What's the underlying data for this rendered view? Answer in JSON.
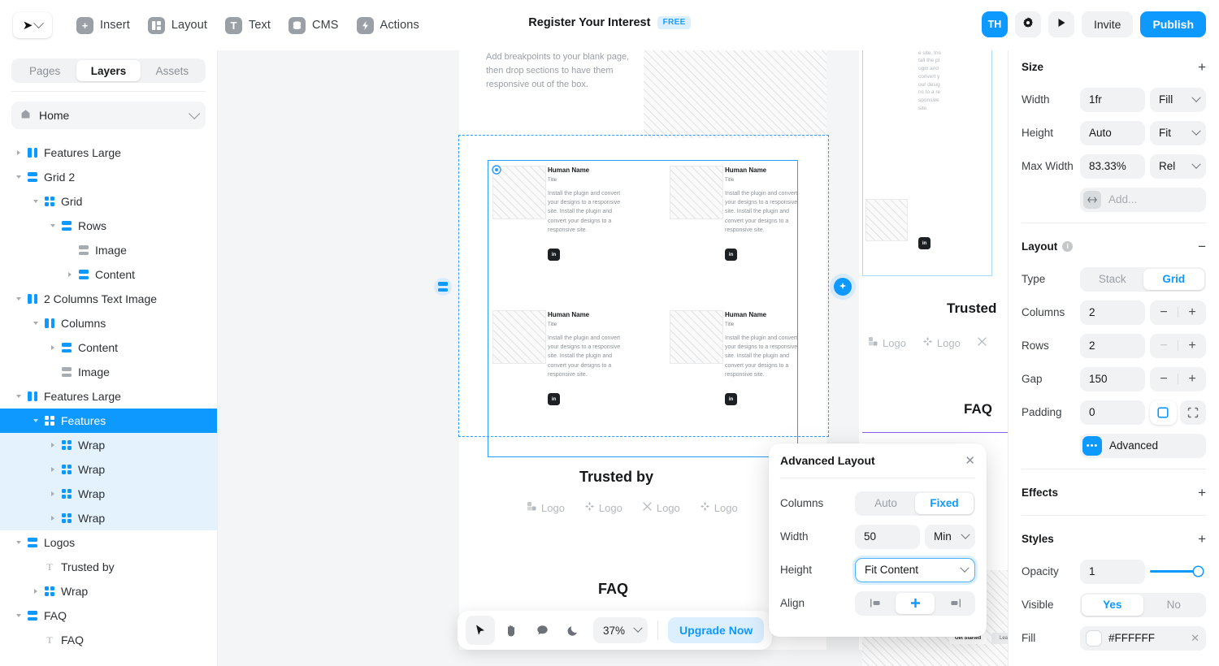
{
  "topbar": {
    "logo_icon": "framer-logo-icon",
    "logo_chevron": "chevron-down-icon",
    "menu": [
      {
        "label": "Insert",
        "icon": "plus-icon",
        "glyph": "+"
      },
      {
        "label": "Layout",
        "icon": "layout-icon",
        "glyph": "▥"
      },
      {
        "label": "Text",
        "icon": "text-icon",
        "glyph": "T"
      },
      {
        "label": "CMS",
        "icon": "database-icon",
        "glyph": "≡"
      },
      {
        "label": "Actions",
        "icon": "lightning-icon",
        "glyph": "⚡"
      }
    ],
    "doc_title": "Register Your Interest",
    "plan_badge": "FREE",
    "avatar_initials": "TH",
    "settings_icon": "gear-icon",
    "preview_icon": "play-icon",
    "invite_label": "Invite",
    "publish_label": "Publish",
    "accent": "#0d99ff"
  },
  "left_panel": {
    "tabs": [
      {
        "label": "Pages",
        "active": false
      },
      {
        "label": "Layers",
        "active": true
      },
      {
        "label": "Assets",
        "active": false
      }
    ],
    "page": {
      "label": "Home",
      "icon": "home-icon",
      "chevron": "chevron-down-icon"
    },
    "layers": [
      {
        "label": "Features Large",
        "icon": "columns-icon",
        "depth": 1,
        "twisty": "collapsed",
        "state": "normal"
      },
      {
        "label": "Grid 2",
        "icon": "rows-icon",
        "depth": 1,
        "twisty": "expanded",
        "state": "normal"
      },
      {
        "label": "Grid",
        "icon": "grid-icon",
        "depth": 2,
        "twisty": "expanded",
        "state": "normal"
      },
      {
        "label": "Rows",
        "icon": "rows-icon",
        "depth": 3,
        "twisty": "expanded",
        "state": "normal"
      },
      {
        "label": "Image",
        "icon": "image-icon",
        "depth": 4,
        "twisty": "none",
        "state": "normal"
      },
      {
        "label": "Content",
        "icon": "rows-icon",
        "depth": 4,
        "twisty": "collapsed",
        "state": "normal"
      },
      {
        "label": "2 Columns Text Image",
        "icon": "columns-icon",
        "depth": 1,
        "twisty": "expanded",
        "state": "normal"
      },
      {
        "label": "Columns",
        "icon": "columns-icon",
        "depth": 2,
        "twisty": "expanded",
        "state": "normal"
      },
      {
        "label": "Content",
        "icon": "rows-icon",
        "depth": 3,
        "twisty": "collapsed",
        "state": "normal"
      },
      {
        "label": "Image",
        "icon": "image-icon",
        "depth": 3,
        "twisty": "none",
        "state": "normal"
      },
      {
        "label": "Features Large",
        "icon": "columns-icon",
        "depth": 1,
        "twisty": "expanded",
        "state": "normal"
      },
      {
        "label": "Features",
        "icon": "grid-icon",
        "depth": 2,
        "twisty": "expanded",
        "state": "selected"
      },
      {
        "label": "Wrap",
        "icon": "grid-icon",
        "depth": 3,
        "twisty": "collapsed",
        "state": "highlighted"
      },
      {
        "label": "Wrap",
        "icon": "grid-icon",
        "depth": 3,
        "twisty": "collapsed",
        "state": "highlighted"
      },
      {
        "label": "Wrap",
        "icon": "grid-icon",
        "depth": 3,
        "twisty": "collapsed",
        "state": "highlighted"
      },
      {
        "label": "Wrap",
        "icon": "grid-icon",
        "depth": 3,
        "twisty": "collapsed",
        "state": "highlighted"
      },
      {
        "label": "Logos",
        "icon": "rows-icon",
        "depth": 1,
        "twisty": "expanded",
        "state": "normal"
      },
      {
        "label": "Trusted by",
        "icon": "text-layer-icon",
        "depth": 2,
        "twisty": "none",
        "state": "normal"
      },
      {
        "label": "Wrap",
        "icon": "grid-icon",
        "depth": 2,
        "twisty": "collapsed",
        "state": "normal"
      },
      {
        "label": "FAQ",
        "icon": "rows-icon",
        "depth": 1,
        "twisty": "expanded",
        "state": "normal"
      },
      {
        "label": "FAQ",
        "icon": "text-layer-icon",
        "depth": 2,
        "twisty": "none",
        "state": "normal"
      }
    ]
  },
  "canvas": {
    "breakpoint_note": "Add breakpoints to your blank page, then drop sections to have them responsive out of the box.",
    "cards": [
      {
        "name": "Human Name",
        "title": "Title",
        "body": "Install the plugin and convert your designs to a responsive site. Install the plugin and convert your designs to a responsive site.",
        "social_icon": "linkedin-icon",
        "social_glyph": "in"
      },
      {
        "name": "Human Name",
        "title": "Title",
        "body": "Install the plugin and convert your designs to a responsive site. Install the plugin and convert your designs to a responsive site.",
        "social_icon": "linkedin-icon",
        "social_glyph": "in"
      },
      {
        "name": "Human Name",
        "title": "Title",
        "body": "Install the plugin and convert your designs to a responsive site. Install the plugin and convert your designs to a responsive site.",
        "social_icon": "linkedin-icon",
        "social_glyph": "in"
      },
      {
        "name": "Human Name",
        "title": "Title",
        "body": "Install the plugin and convert your designs to a responsive site. Install the plugin and convert your designs to a responsive site.",
        "social_icon": "linkedin-icon",
        "social_glyph": "in"
      }
    ],
    "trusted_by": "Trusted by",
    "logos": [
      {
        "label": "Logo",
        "icon": "blocks-logo-icon"
      },
      {
        "label": "Logo",
        "icon": "clover-logo-icon"
      },
      {
        "label": "Logo",
        "icon": "cross-logo-icon"
      },
      {
        "label": "Logo",
        "icon": "diamond-logo-icon"
      }
    ],
    "faq": "FAQ",
    "mobile_trusted_by": "Trusted",
    "mobile_faq": "FAQ",
    "get_started": "Get Started",
    "learn_more": "Lea",
    "add_badge_icon": "add-section-icon",
    "rows-badge_icon": "rows-handle-icon"
  },
  "canvas_toolbar": {
    "tools": [
      {
        "icon": "cursor-icon",
        "glyph": "➤",
        "active": true
      },
      {
        "icon": "hand-icon",
        "glyph": "✋",
        "active": false
      },
      {
        "icon": "comment-icon",
        "glyph": "💬",
        "active": false
      },
      {
        "icon": "moon-icon",
        "glyph": "🌙",
        "active": false
      }
    ],
    "zoom_value": "37%",
    "zoom_chevron": "chevron-down-icon",
    "upgrade_label": "Upgrade Now"
  },
  "popover": {
    "title": "Advanced Layout",
    "close_icon": "close-icon",
    "rows": {
      "columns": {
        "label": "Columns",
        "options": [
          "Auto",
          "Fixed"
        ],
        "selected": "Fixed"
      },
      "width": {
        "label": "Width",
        "value": "50",
        "unit": "Min",
        "unit_chevron": "chevron-down-icon"
      },
      "height": {
        "label": "Height",
        "value": "Fit Content",
        "chevron": "chevron-down-icon",
        "focused": true
      },
      "align": {
        "label": "Align",
        "options": [
          "align-start-icon",
          "align-center-icon",
          "align-end-icon"
        ],
        "selected": 1
      }
    }
  },
  "right_panel": {
    "size": {
      "title": "Size",
      "add_icon": "plus-icon",
      "rows": [
        {
          "label": "Width",
          "value": "1fr",
          "unit": "Fill"
        },
        {
          "label": "Height",
          "value": "Auto",
          "unit": "Fit"
        },
        {
          "label": "Max Width",
          "value": "83.33%",
          "unit": "Rel"
        }
      ],
      "add_field": {
        "placeholder": "Add...",
        "icon": "arrows-horizontal-icon"
      }
    },
    "layout": {
      "title": "Layout",
      "info_icon": "info-icon",
      "collapse_icon": "minus-icon",
      "type": {
        "label": "Type",
        "options": [
          "Stack",
          "Grid"
        ],
        "selected": "Grid"
      },
      "columns": {
        "label": "Columns",
        "value": "2",
        "minus": "−",
        "plus": "+"
      },
      "rows": {
        "label": "Rows",
        "value": "2",
        "minus": "−",
        "plus": "+"
      },
      "gap": {
        "label": "Gap",
        "value": "150",
        "minus": "−",
        "plus": "+"
      },
      "padding": {
        "label": "Padding",
        "value": "0",
        "mode_icons": [
          "padding-all-icon",
          "padding-sides-icon"
        ],
        "selected": 0
      },
      "advanced": {
        "label": "Advanced",
        "icon": "dots-icon"
      }
    },
    "effects": {
      "title": "Effects",
      "add_icon": "plus-icon"
    },
    "styles": {
      "title": "Styles",
      "add_icon": "plus-icon",
      "opacity": {
        "label": "Opacity",
        "value": "1",
        "slider_pct": 100
      },
      "visible": {
        "label": "Visible",
        "options": [
          "Yes",
          "No"
        ],
        "selected": "Yes"
      },
      "fill": {
        "label": "Fill",
        "value": "#FFFFFF",
        "swatch": "#FFFFFF",
        "clear_icon": "close-icon"
      }
    }
  }
}
